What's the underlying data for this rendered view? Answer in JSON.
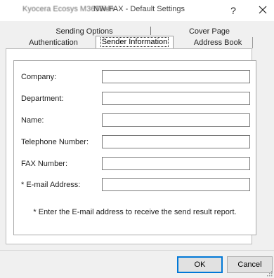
{
  "window": {
    "title_blurred": "Kyocera Ecosys M3655idn",
    "title_suffix": "NW-FAX - Default Settings",
    "help_label": "?",
    "close_label": "close"
  },
  "tabs": {
    "row1": [
      "Sending Options",
      "Cover Page"
    ],
    "row2": [
      "Authentication",
      "Sender Information",
      "Address Book"
    ],
    "active": "Sender Information"
  },
  "fields": [
    {
      "label": "Company:",
      "value": ""
    },
    {
      "label": "Department:",
      "value": ""
    },
    {
      "label": "Name:",
      "value": ""
    },
    {
      "label": "Telephone Number:",
      "value": ""
    },
    {
      "label": "FAX Number:",
      "value": ""
    },
    {
      "label": "* E-mail Address:",
      "value": ""
    }
  ],
  "note": "* Enter the E-mail address to receive the send result report.",
  "buttons": {
    "ok": "OK",
    "cancel": "Cancel"
  }
}
